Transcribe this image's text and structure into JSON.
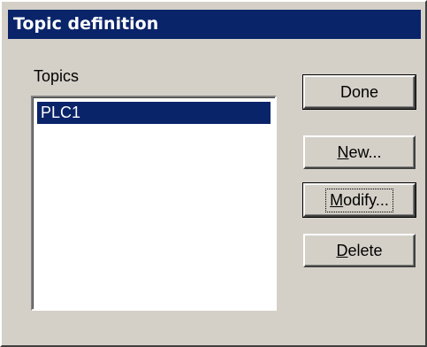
{
  "dialog": {
    "title": "Topic definition"
  },
  "topics": {
    "label": "Topics",
    "items": [
      {
        "label": "PLC1",
        "selected": true
      }
    ]
  },
  "buttons": {
    "done": {
      "label": "Done"
    },
    "new": {
      "accel": "N",
      "rest": "ew..."
    },
    "modify": {
      "accel": "M",
      "rest": "odify..."
    },
    "delete": {
      "accel": "D",
      "rest": "elete"
    }
  }
}
